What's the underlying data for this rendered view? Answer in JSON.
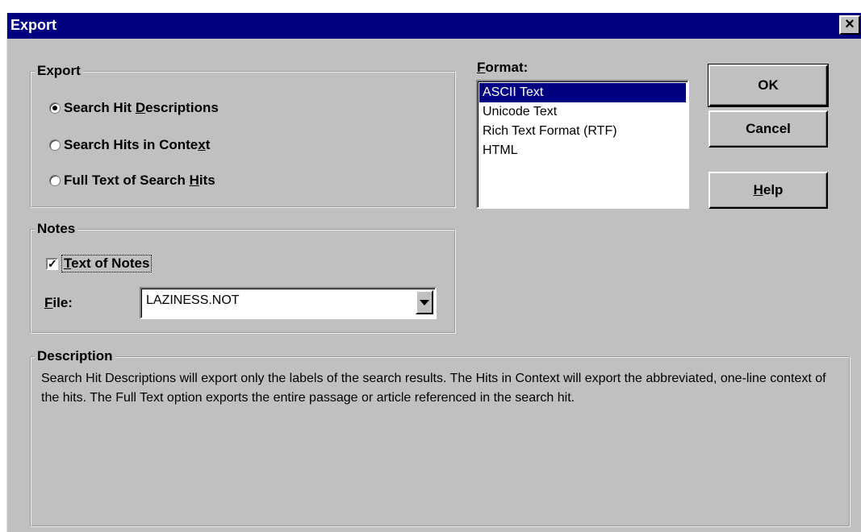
{
  "window": {
    "title": "Export",
    "close_glyph": "×"
  },
  "export_group": {
    "legend": "Export",
    "options": [
      {
        "pre": "Search Hit ",
        "key": "D",
        "post": "escriptions",
        "checked": true
      },
      {
        "pre": "Search Hits in Conte",
        "key": "x",
        "post": "t",
        "checked": false
      },
      {
        "pre": "Full Text of Search ",
        "key": "H",
        "post": "its",
        "checked": false
      }
    ]
  },
  "format": {
    "label_key": "F",
    "label_rest": "ormat:",
    "items": [
      "ASCII Text",
      "Unicode Text",
      "Rich Text Format (RTF)",
      "HTML"
    ],
    "selected_index": 0
  },
  "buttons": {
    "ok": "OK",
    "cancel": "Cancel",
    "help_key": "H",
    "help_rest": "elp"
  },
  "notes_group": {
    "legend": "Notes",
    "checkbox_key": "T",
    "checkbox_rest": "ext of Notes",
    "checkbox_checked": true,
    "check_glyph": "✓",
    "file_label_key": "F",
    "file_label_rest": "ile:",
    "file_value": "LAZINESS.NOT"
  },
  "description_group": {
    "legend": "Description",
    "text": "Search Hit Descriptions will export only the labels of the search results. The Hits in Context will export the abbreviated, one-line context of the hits. The Full Text option exports the entire passage or article referenced in the search hit."
  },
  "icons": {
    "close": "close-icon",
    "dropdown": "chevron-down-icon",
    "radio": "radio-icon",
    "checkbox": "checkbox-icon"
  },
  "colors": {
    "titlebar": "#000080",
    "face": "#c0c0c0",
    "selection": "#000080"
  }
}
